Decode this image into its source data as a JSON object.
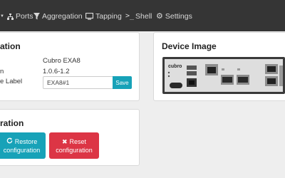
{
  "navbar": {
    "items": [
      {
        "label": "Ports",
        "icon": "network-icon"
      },
      {
        "label": "Aggregation",
        "icon": "filter-icon"
      },
      {
        "label": "Tapping",
        "icon": "monitor-icon"
      },
      {
        "label": "Shell",
        "icon": "terminal-icon"
      },
      {
        "label": "Settings",
        "icon": "gear-icon"
      }
    ]
  },
  "info_panel": {
    "title": "ation",
    "rows": [
      {
        "label": "n",
        "value": "Cubro EXA8"
      },
      {
        "label": "",
        "value": "1.0.6-1.2"
      },
      {
        "label": "e Label"
      }
    ],
    "label_input_value": "EXA8#1",
    "save_label": "Save"
  },
  "config_panel": {
    "title": "ration",
    "restore_line1": "Restore",
    "restore_line2": "configuration",
    "reset_line1": "Reset",
    "reset_line2": "configuration"
  },
  "device_panel": {
    "title": "Device Image",
    "logo_text": "cubro"
  },
  "colors": {
    "navbar_bg": "#353535",
    "info_button": "#17a2b8",
    "danger_button": "#dc3545"
  }
}
